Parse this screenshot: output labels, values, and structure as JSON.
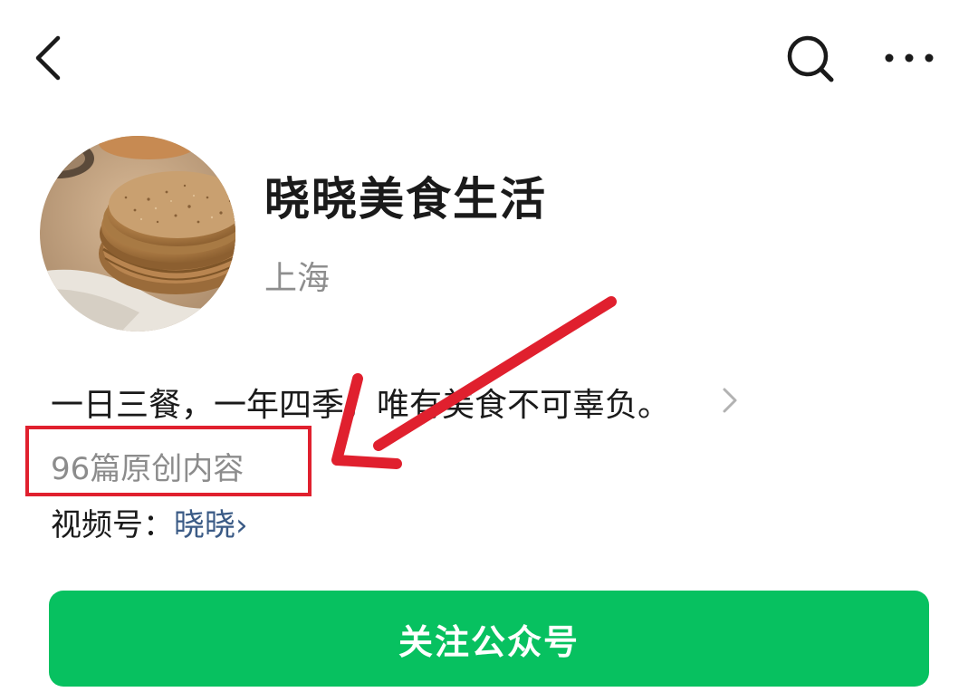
{
  "profile": {
    "name": "晓晓美食生活",
    "location": "上海",
    "bio": "一日三餐，一年四季，唯有美食不可辜负。",
    "original_content": "96篇原创内容",
    "video_channel_label": "视频号：",
    "video_channel_name": "晓晓",
    "video_channel_chevron": "›"
  },
  "actions": {
    "follow_label": "关注公众号"
  },
  "icons": {
    "back": "back-arrow-icon",
    "search": "search-icon",
    "more": "more-dots-icon",
    "bio_expand": "chevron-right-icon"
  },
  "colors": {
    "follow_button": "#07c160",
    "highlight": "#e0202e",
    "link": "#3b5b86"
  }
}
